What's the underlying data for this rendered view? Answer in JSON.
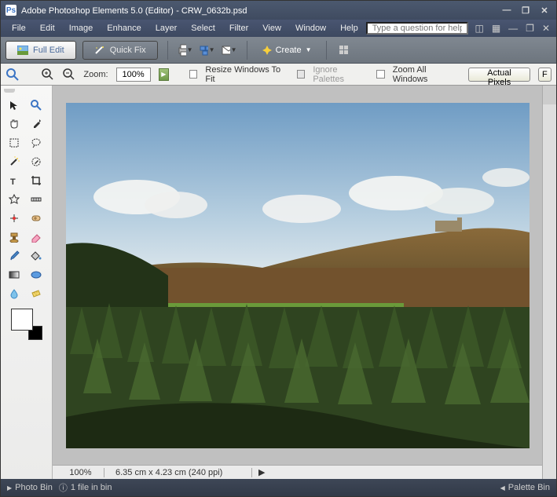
{
  "titlebar": {
    "app_prefix": "Adobe Photoshop Elements 5.0 (Editor)",
    "document": "CRW_0632b.psd"
  },
  "menubar": {
    "items": [
      "File",
      "Edit",
      "Image",
      "Enhance",
      "Layer",
      "Select",
      "Filter",
      "View",
      "Window",
      "Help"
    ],
    "help_placeholder": "Type a question for help"
  },
  "modesbar": {
    "full_edit": "Full Edit",
    "quick_fix": "Quick Fix",
    "create": "Create"
  },
  "optionsbar": {
    "zoom_label": "Zoom:",
    "zoom_value": "100%",
    "resize_windows": "Resize Windows To Fit",
    "ignore_palettes": "Ignore Palettes",
    "zoom_all": "Zoom All Windows",
    "actual_pixels": "Actual Pixels",
    "fit": "F"
  },
  "doc_status": {
    "zoom": "100%",
    "info": "6.35 cm x 4.23 cm (240 ppi)"
  },
  "footer": {
    "photo_bin": "Photo Bin",
    "files": "1 file in bin",
    "palette_bin": "Palette Bin"
  },
  "colors": {
    "accent": "#4c596f",
    "brand": "#3b74c4"
  }
}
